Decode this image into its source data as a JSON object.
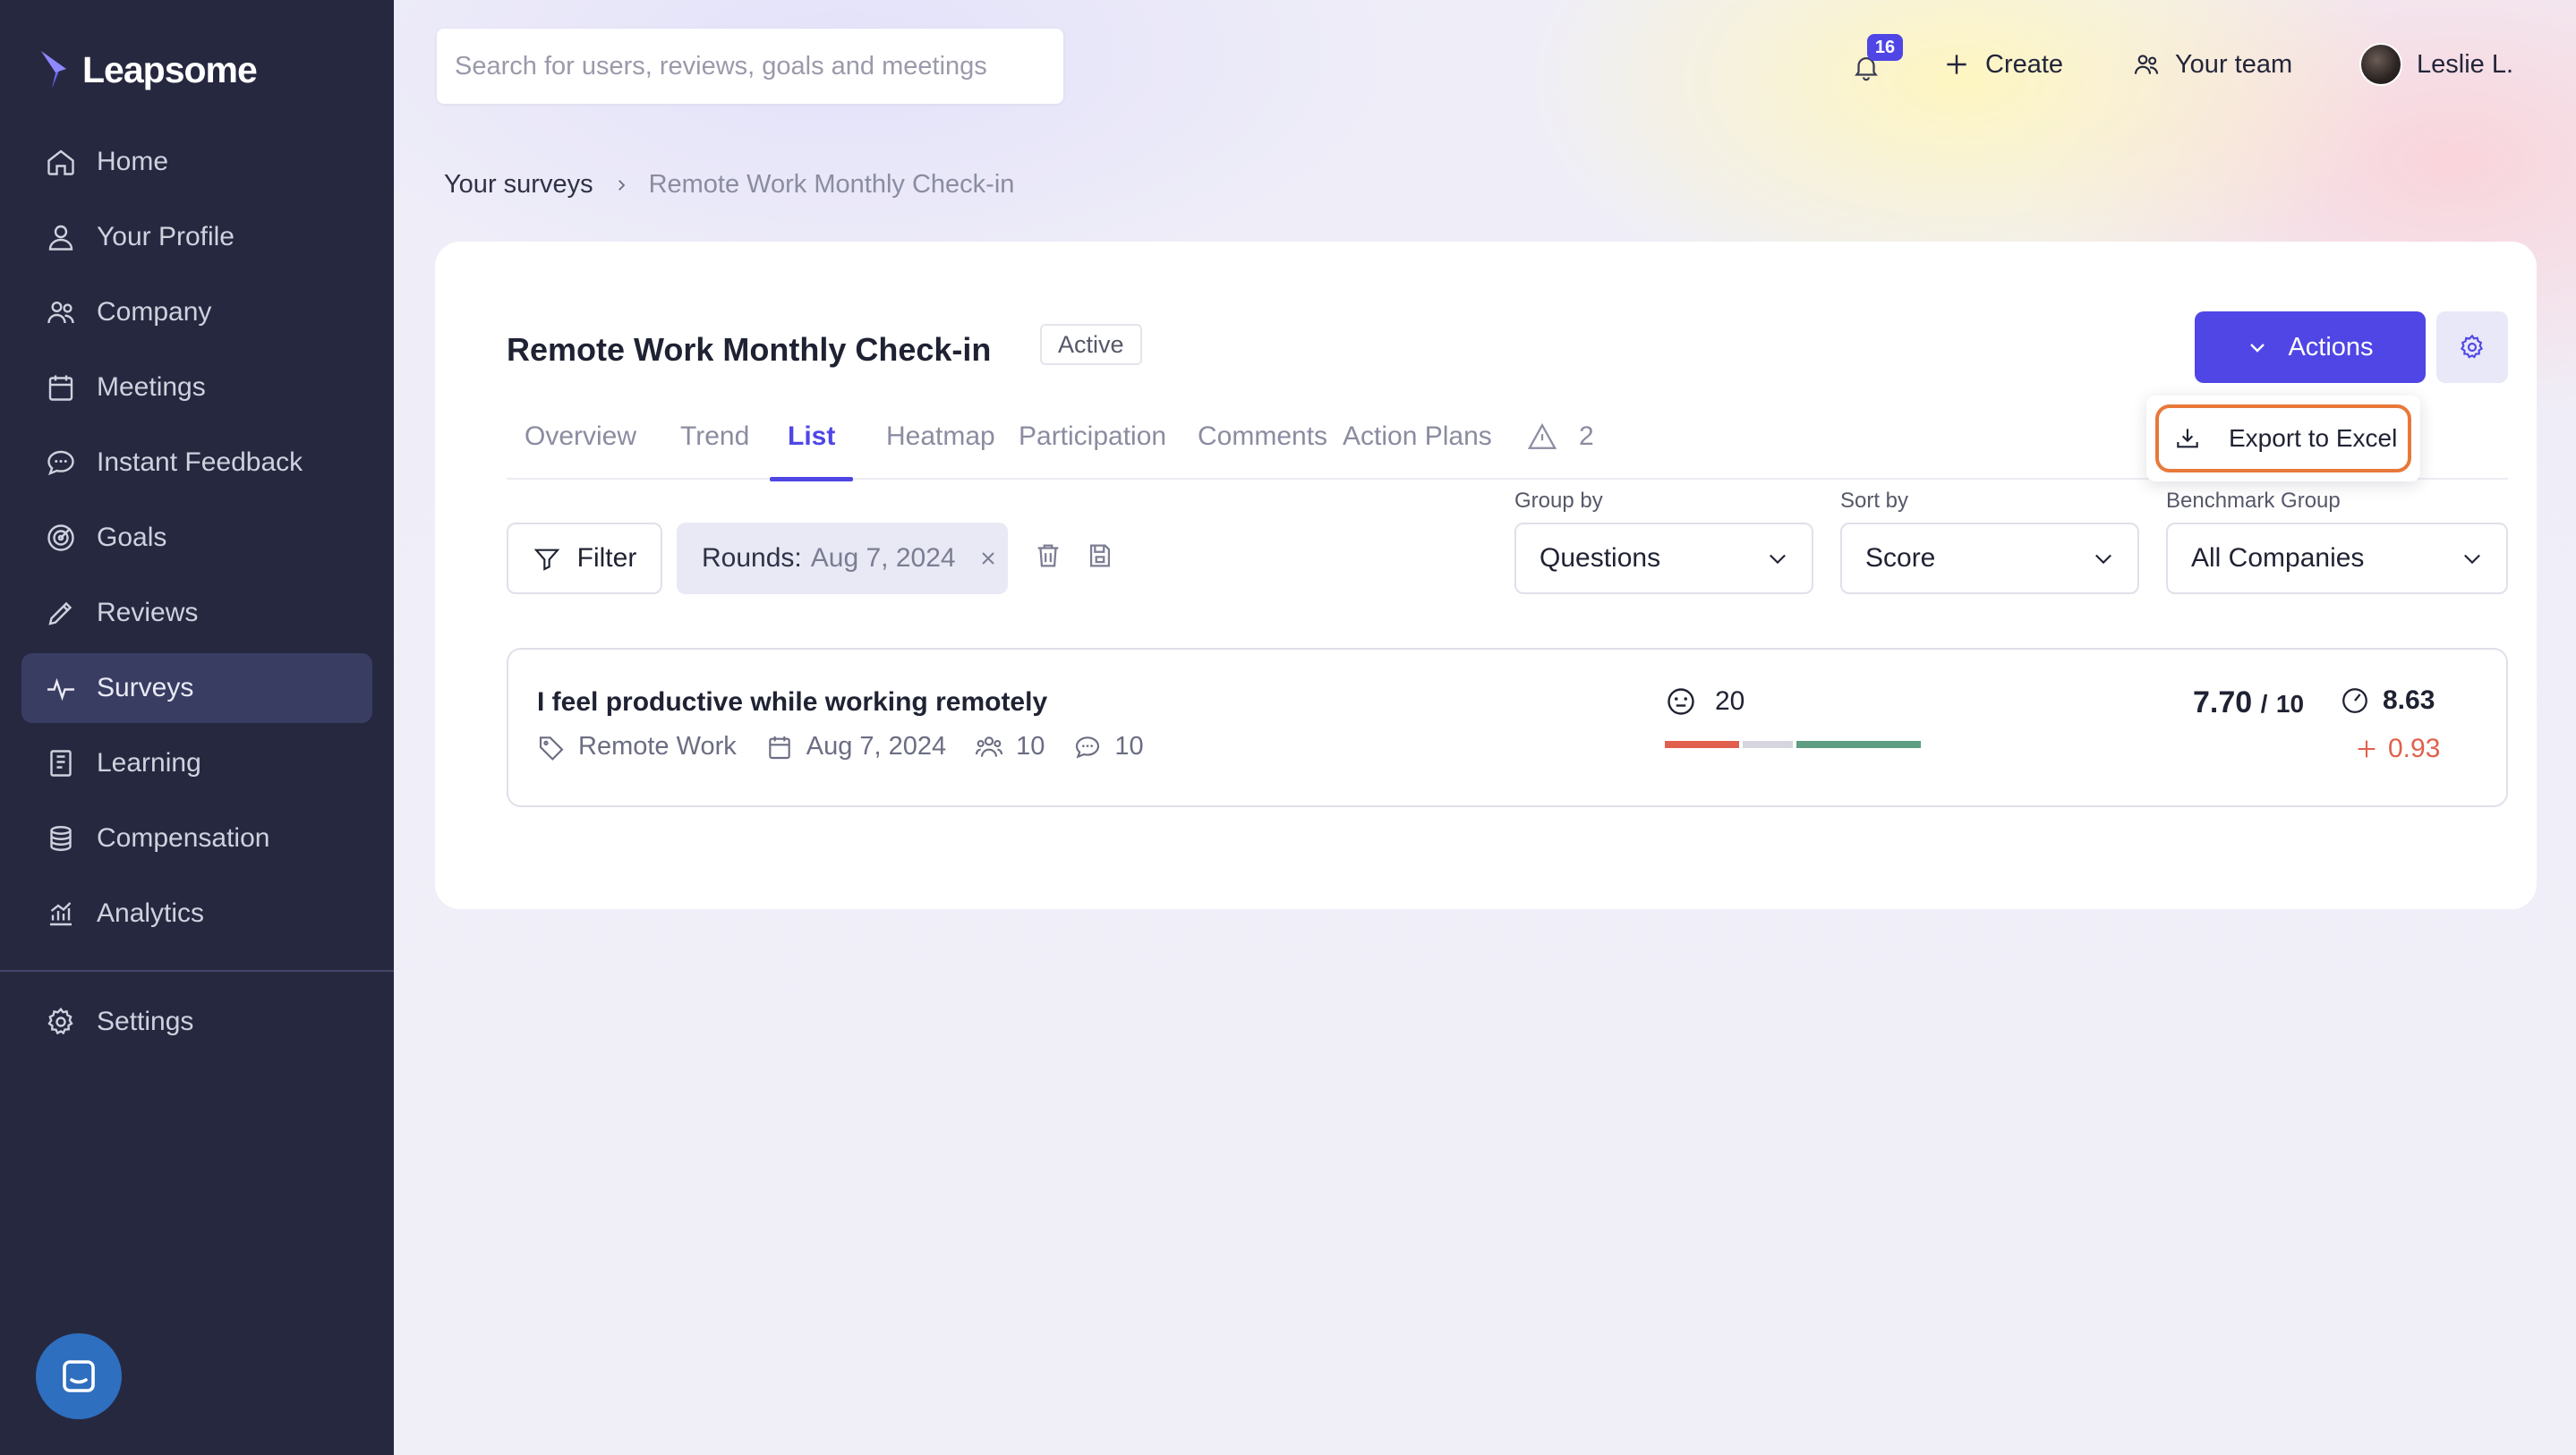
{
  "app": {
    "logo_text": "Leapsome"
  },
  "sidebar": {
    "items": [
      {
        "label": "Home",
        "icon": "home-icon"
      },
      {
        "label": "Your Profile",
        "icon": "user-icon"
      },
      {
        "label": "Company",
        "icon": "people-icon"
      },
      {
        "label": "Meetings",
        "icon": "calendar-icon"
      },
      {
        "label": "Instant Feedback",
        "icon": "chat-icon"
      },
      {
        "label": "Goals",
        "icon": "target-icon"
      },
      {
        "label": "Reviews",
        "icon": "pencil-icon"
      },
      {
        "label": "Surveys",
        "icon": "pulse-icon",
        "active": true
      },
      {
        "label": "Learning",
        "icon": "book-icon"
      },
      {
        "label": "Compensation",
        "icon": "coins-icon"
      },
      {
        "label": "Analytics",
        "icon": "chart-icon"
      }
    ],
    "settings_label": "Settings"
  },
  "topbar": {
    "search_placeholder": "Search for users, reviews, goals and meetings",
    "notification_count": "16",
    "create_label": "Create",
    "team_label": "Your team",
    "user_name": "Leslie L."
  },
  "breadcrumb": {
    "parent": "Your surveys",
    "current": "Remote Work Monthly Check-in"
  },
  "survey": {
    "title": "Remote Work Monthly Check-in",
    "status": "Active",
    "actions_label": "Actions",
    "dropdown_export": "Export to Excel"
  },
  "tabs": [
    {
      "label": "Overview"
    },
    {
      "label": "Trend"
    },
    {
      "label": "List",
      "active": true
    },
    {
      "label": "Heatmap"
    },
    {
      "label": "Participation"
    },
    {
      "label": "Comments"
    },
    {
      "label": "Action Plans"
    }
  ],
  "warnings_count": "2",
  "filters": {
    "filter_label": "Filter",
    "chip_label": "Rounds:",
    "chip_value": "Aug 7, 2024",
    "group_by": {
      "label": "Group by",
      "value": "Questions"
    },
    "sort_by": {
      "label": "Sort by",
      "value": "Score"
    },
    "benchmark": {
      "label": "Benchmark Group",
      "value": "All Companies"
    }
  },
  "questions": [
    {
      "text": "I feel productive while working remotely",
      "category": "Remote Work",
      "date": "Aug 7, 2024",
      "participants": "10",
      "comments": "10",
      "sentiment_count": "20",
      "score": "7.70",
      "score_sep": "/",
      "score_max": "10",
      "benchmark": "8.63",
      "delta": "0.93",
      "distribution": [
        {
          "fraction": 0.3,
          "color": "#e0604d"
        },
        {
          "fraction": 0.2,
          "color": "#d5d6de"
        },
        {
          "fraction": 0.5,
          "color": "#5e9e82"
        }
      ]
    }
  ],
  "colors": {
    "accent": "#4f46e5",
    "sidebar_bg": "#262840",
    "highlight_outline": "#e8783a",
    "delta_color": "#e0604d"
  }
}
